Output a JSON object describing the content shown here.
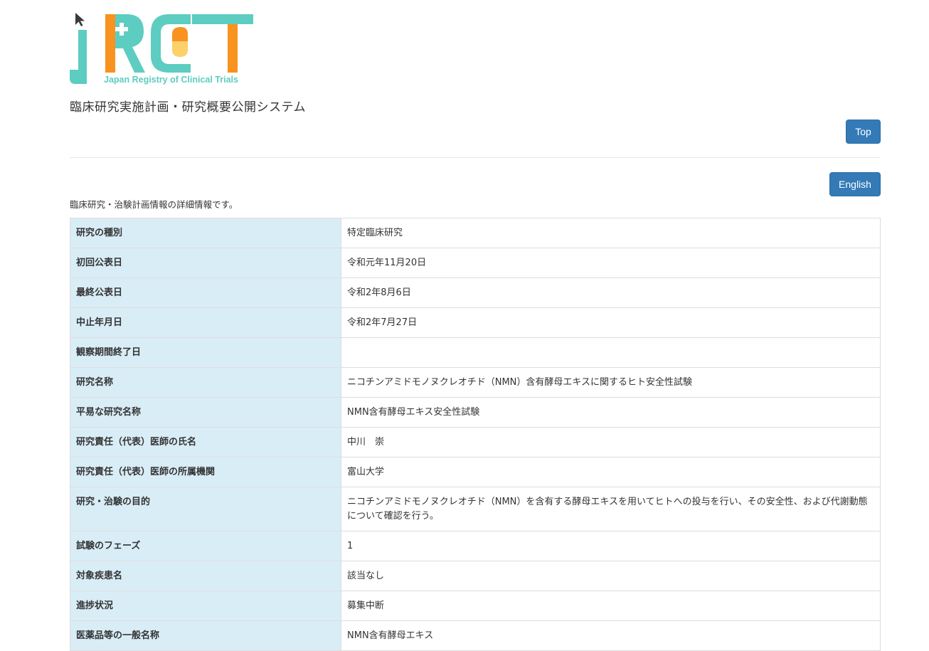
{
  "header": {
    "logo_letters": "jRCT",
    "logo_subtitle": "Japan Registry of Clinical Trials",
    "system_title": "臨床研究実施計画・研究概要公開システム",
    "top_button": "Top",
    "english_button": "English",
    "intro_text": "臨床研究・治験計画情報の詳細情報です。"
  },
  "colors": {
    "teal": "#5ccdc0",
    "orange": "#f7931e",
    "yellow": "#fcd06b",
    "button_blue": "#337ab7",
    "label_bg": "#d9edf7"
  },
  "rows": [
    {
      "label": "研究の種別",
      "value": "特定臨床研究"
    },
    {
      "label": "初回公表日",
      "value": "令和元年11月20日"
    },
    {
      "label": "最終公表日",
      "value": "令和2年8月6日"
    },
    {
      "label": "中止年月日",
      "value": "令和2年7月27日"
    },
    {
      "label": "観察期間終了日",
      "value": ""
    },
    {
      "label": "研究名称",
      "value": "ニコチンアミドモノヌクレオチド（NMN）含有酵母エキスに関するヒト安全性試験"
    },
    {
      "label": "平易な研究名称",
      "value": "NMN含有酵母エキス安全性試験"
    },
    {
      "label": "研究責任（代表）医師の氏名",
      "value": "中川　崇"
    },
    {
      "label": "研究責任（代表）医師の所属機関",
      "value": "富山大学"
    },
    {
      "label": "研究・治験の目的",
      "value": "ニコチンアミドモノヌクレオチド（NMN）を含有する酵母エキスを用いてヒトへの投与を行い、その安全性、および代謝動態について確認を行う。"
    },
    {
      "label": "試験のフェーズ",
      "value": "1"
    },
    {
      "label": "対象疾患名",
      "value": "該当なし"
    },
    {
      "label": "進捗状況",
      "value": "募集中断"
    },
    {
      "label": "医薬品等の一般名称",
      "value": "NMN含有酵母エキス"
    }
  ]
}
